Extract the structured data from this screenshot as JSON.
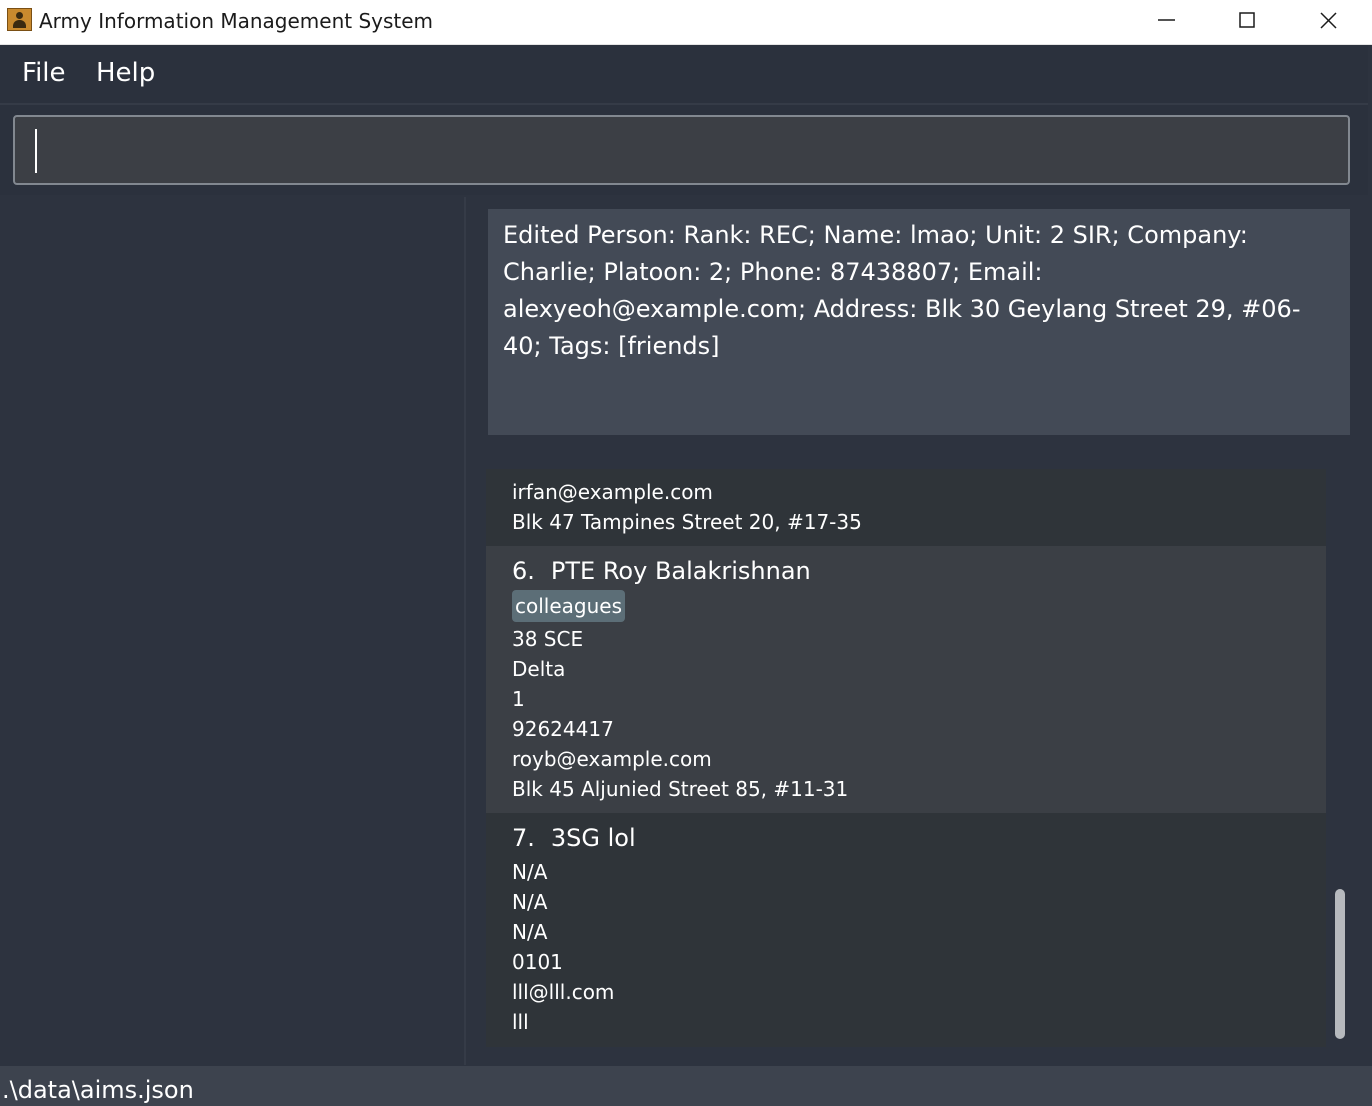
{
  "window": {
    "title": "Army Information Management System"
  },
  "menu": {
    "file_label": "File",
    "help_label": "Help"
  },
  "command": {
    "value": "",
    "placeholder": ""
  },
  "result": {
    "text": "Edited Person: Rank: REC; Name: lmao; Unit: 2 SIR; Company: Charlie; Platoon: 2; Phone: 87438807; Email: alexyeoh@example.com; Address: Blk 30 Geylang Street 29, #06-40; Tags: [friends]"
  },
  "persons": {
    "partial": {
      "email": "irfan@example.com",
      "address": "Blk 47 Tampines Street 20, #17-35"
    },
    "roy": {
      "index": "6.",
      "name": "PTE Roy Balakrishnan",
      "tag": "colleagues",
      "unit": "38 SCE",
      "company": "Delta",
      "platoon": "1",
      "phone": "92624417",
      "email": "royb@example.com",
      "address": "Blk 45 Aljunied Street 85, #11-31"
    },
    "lol": {
      "index": "7.",
      "name": "3SG lol",
      "unit": "N/A",
      "company": "N/A",
      "platoon": "N/A",
      "phone": "0101",
      "email": "lll@lll.com",
      "address": "lll"
    }
  },
  "status": {
    "path": ".\\data\\aims.json"
  },
  "colors": {
    "background": "#2d333f",
    "result_box": "#434a56",
    "tag": "#5c6e77"
  }
}
